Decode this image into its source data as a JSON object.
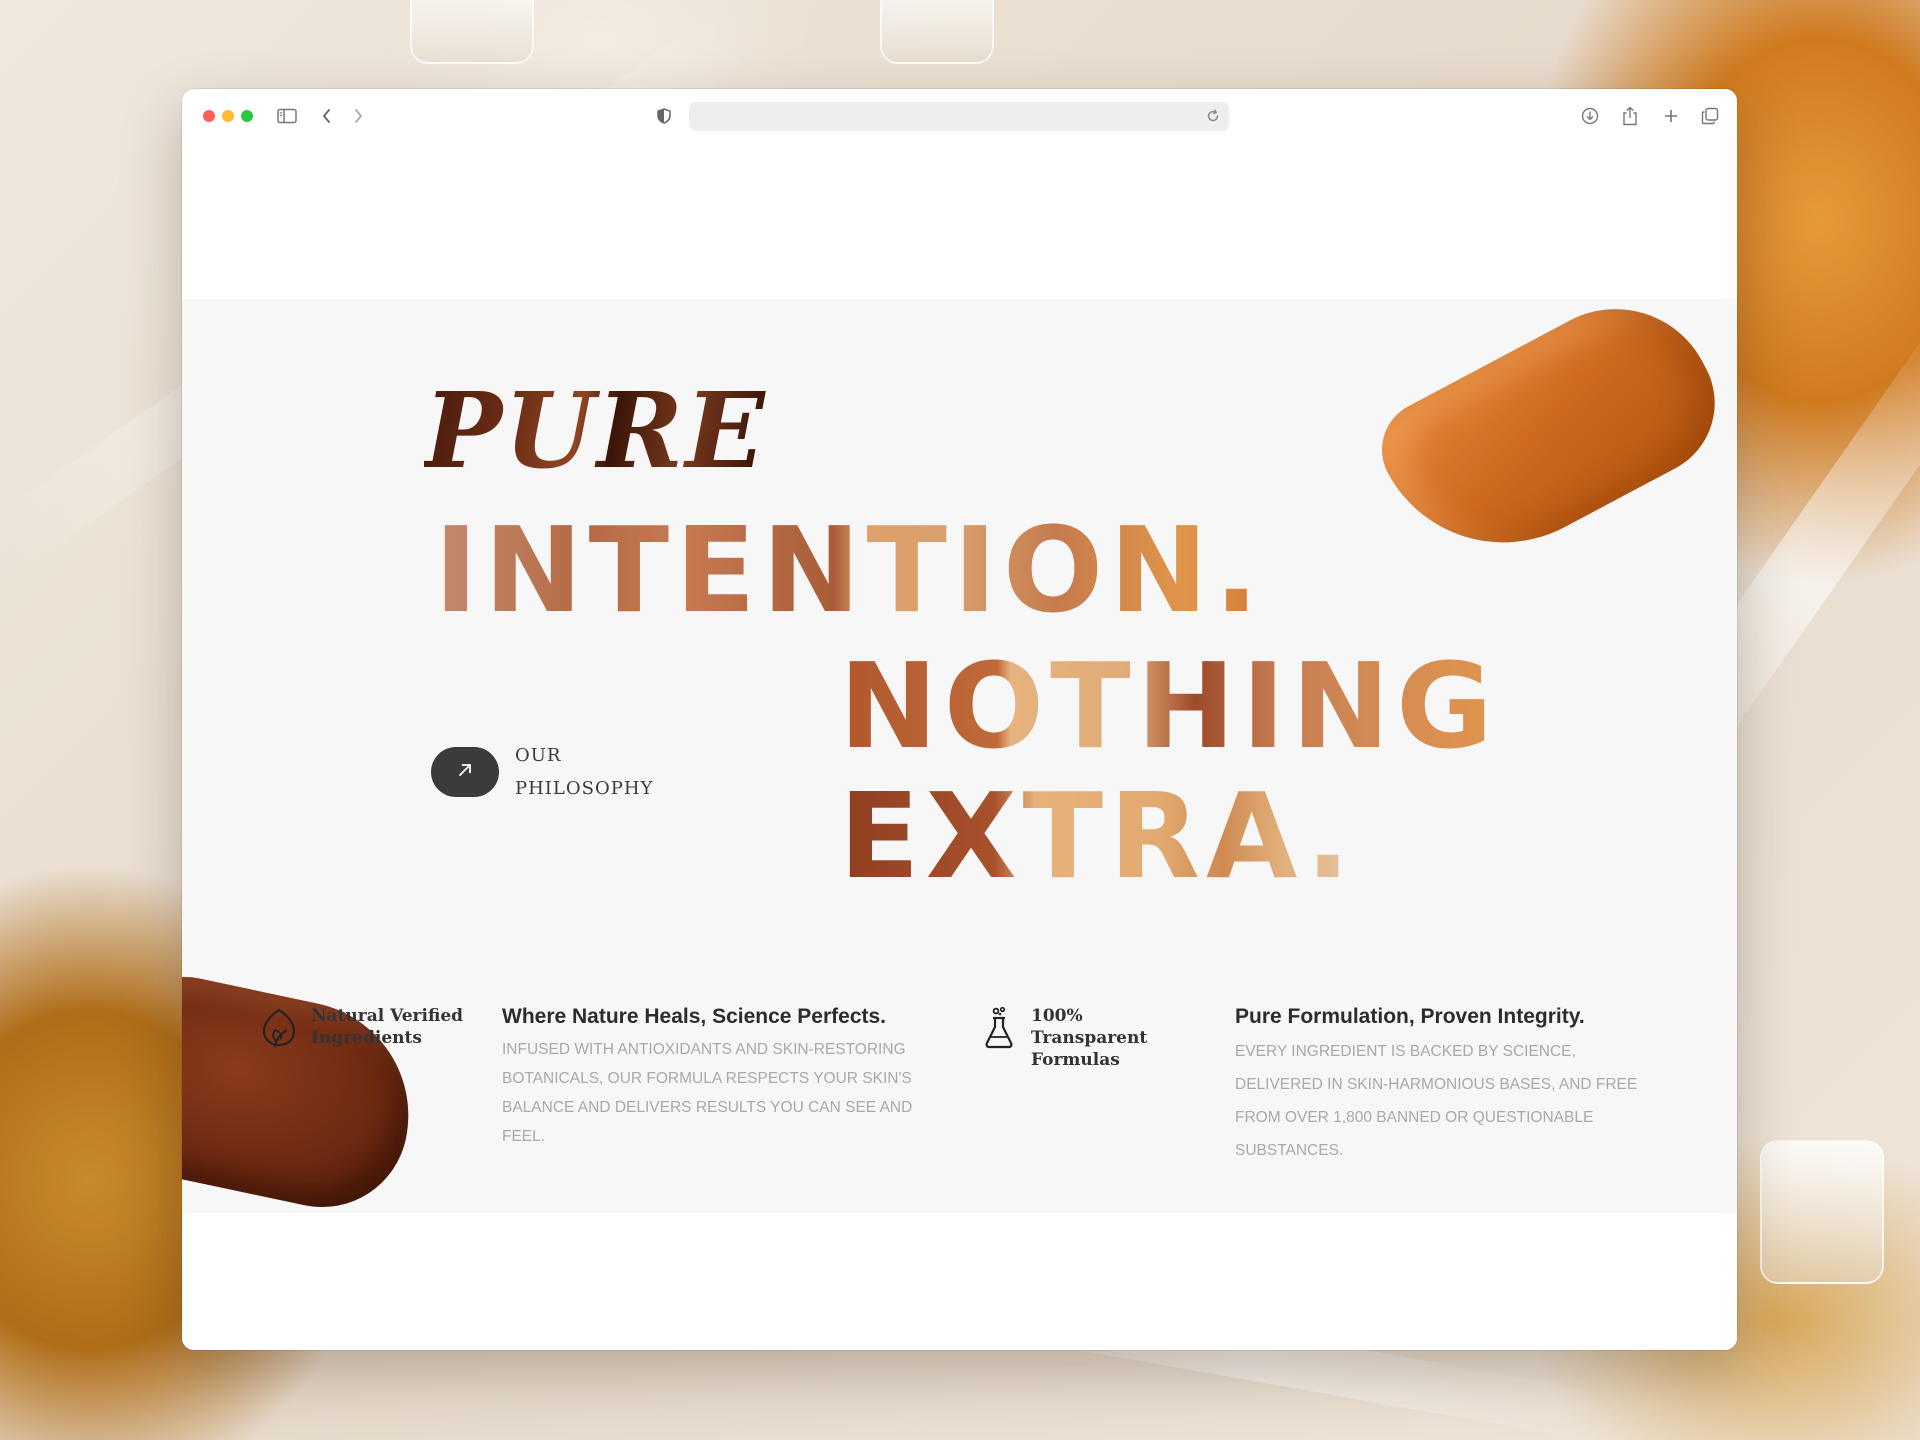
{
  "colors": {
    "window_bg": "#ffffff",
    "hero_bg": "#f7f7f7",
    "cta_button": "#3b3b3b",
    "heading_dark": "#2c2c2c",
    "body_muted": "#a9a9a9",
    "accent_orange": "#cf6a1f",
    "accent_brown": "#6f2a12"
  },
  "browser": {
    "url_value": "",
    "icons": {
      "sidebar": "sidebar-icon",
      "back": "chevron-left-icon",
      "forward": "chevron-right-icon",
      "privacy": "shield-icon",
      "reload": "reload-icon",
      "downloads": "download-icon",
      "share": "share-icon",
      "new_tab": "plus-icon",
      "tabs": "tabs-overview-icon"
    }
  },
  "hero": {
    "headline_line1": "PURE",
    "headline_line2": "INTENTION.",
    "headline_line3": "NOTHING",
    "headline_line4": "EXTRA.",
    "cta": {
      "icon": "arrow-up-right-icon",
      "label_line1": "OUR",
      "label_line2": "PHILOSOPHY"
    }
  },
  "features": [
    {
      "icon": "leaf-icon",
      "title_line1": "Natural Verified",
      "title_line2": "Ingredients",
      "heading": "Where Nature Heals, Science Perfects.",
      "description": "Infused with antioxidants and skin-restoring botanicals, our formula respects your skin's balance and delivers results you can see and feel."
    },
    {
      "icon": "flask-icon",
      "title_line1": "100% Transparent",
      "title_line2": "Formulas",
      "heading": "Pure Formulation, Proven Integrity.",
      "description": "Every ingredient is backed by science, delivered in skin-harmonious bases, and free from over 1,800 banned or questionable substances."
    }
  ]
}
